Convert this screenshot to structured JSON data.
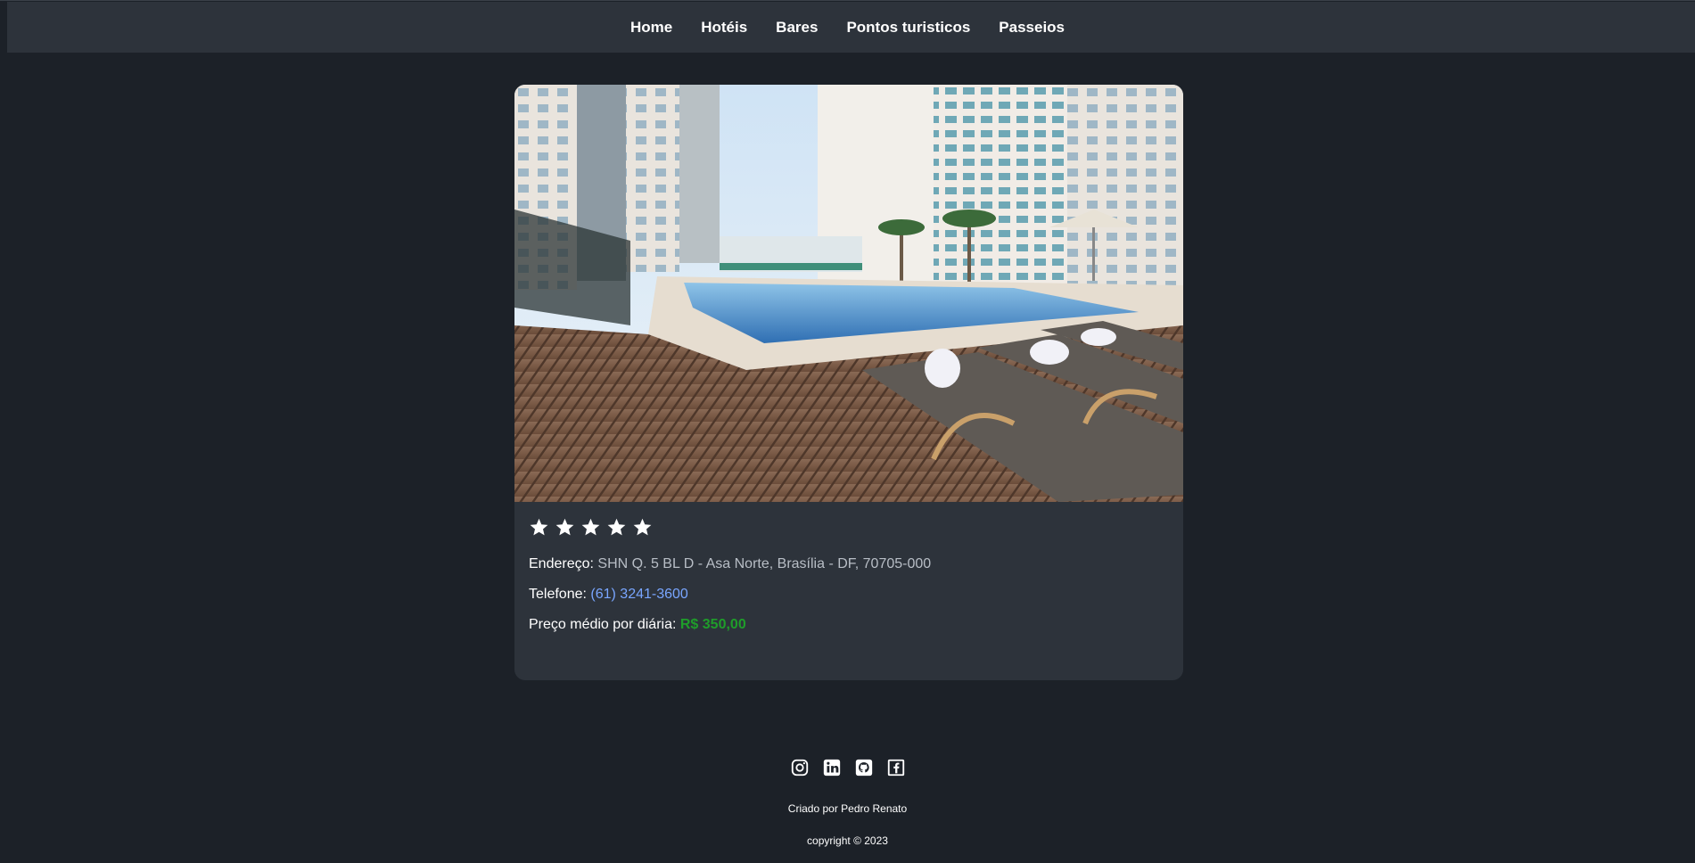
{
  "nav": {
    "items": [
      {
        "label": "Home"
      },
      {
        "label": "Hotéis"
      },
      {
        "label": "Bares"
      },
      {
        "label": "Pontos turisticos"
      },
      {
        "label": "Passeios"
      }
    ]
  },
  "hotel": {
    "photo_icon": "hotel-pool-photo",
    "rating_stars": 5,
    "address_label": "Endereço:",
    "address_value": "SHN Q. 5 BL D - Asa Norte, Brasília - DF, 70705-000",
    "phone_label": "Telefone:",
    "phone_value": "(61) 3241-3600",
    "price_label": "Preço médio por diária:",
    "price_value": "R$ 350,00"
  },
  "footer": {
    "social_icons": [
      "instagram-icon",
      "linkedin-icon",
      "github-icon",
      "facebook-icon"
    ],
    "credit": "Criado por Pedro Renato",
    "copyright": "copyright © 2023"
  },
  "colors": {
    "background": "#1c2128",
    "surface": "#2d333b",
    "link": "#79a6ff",
    "price": "#1f9d2a"
  }
}
